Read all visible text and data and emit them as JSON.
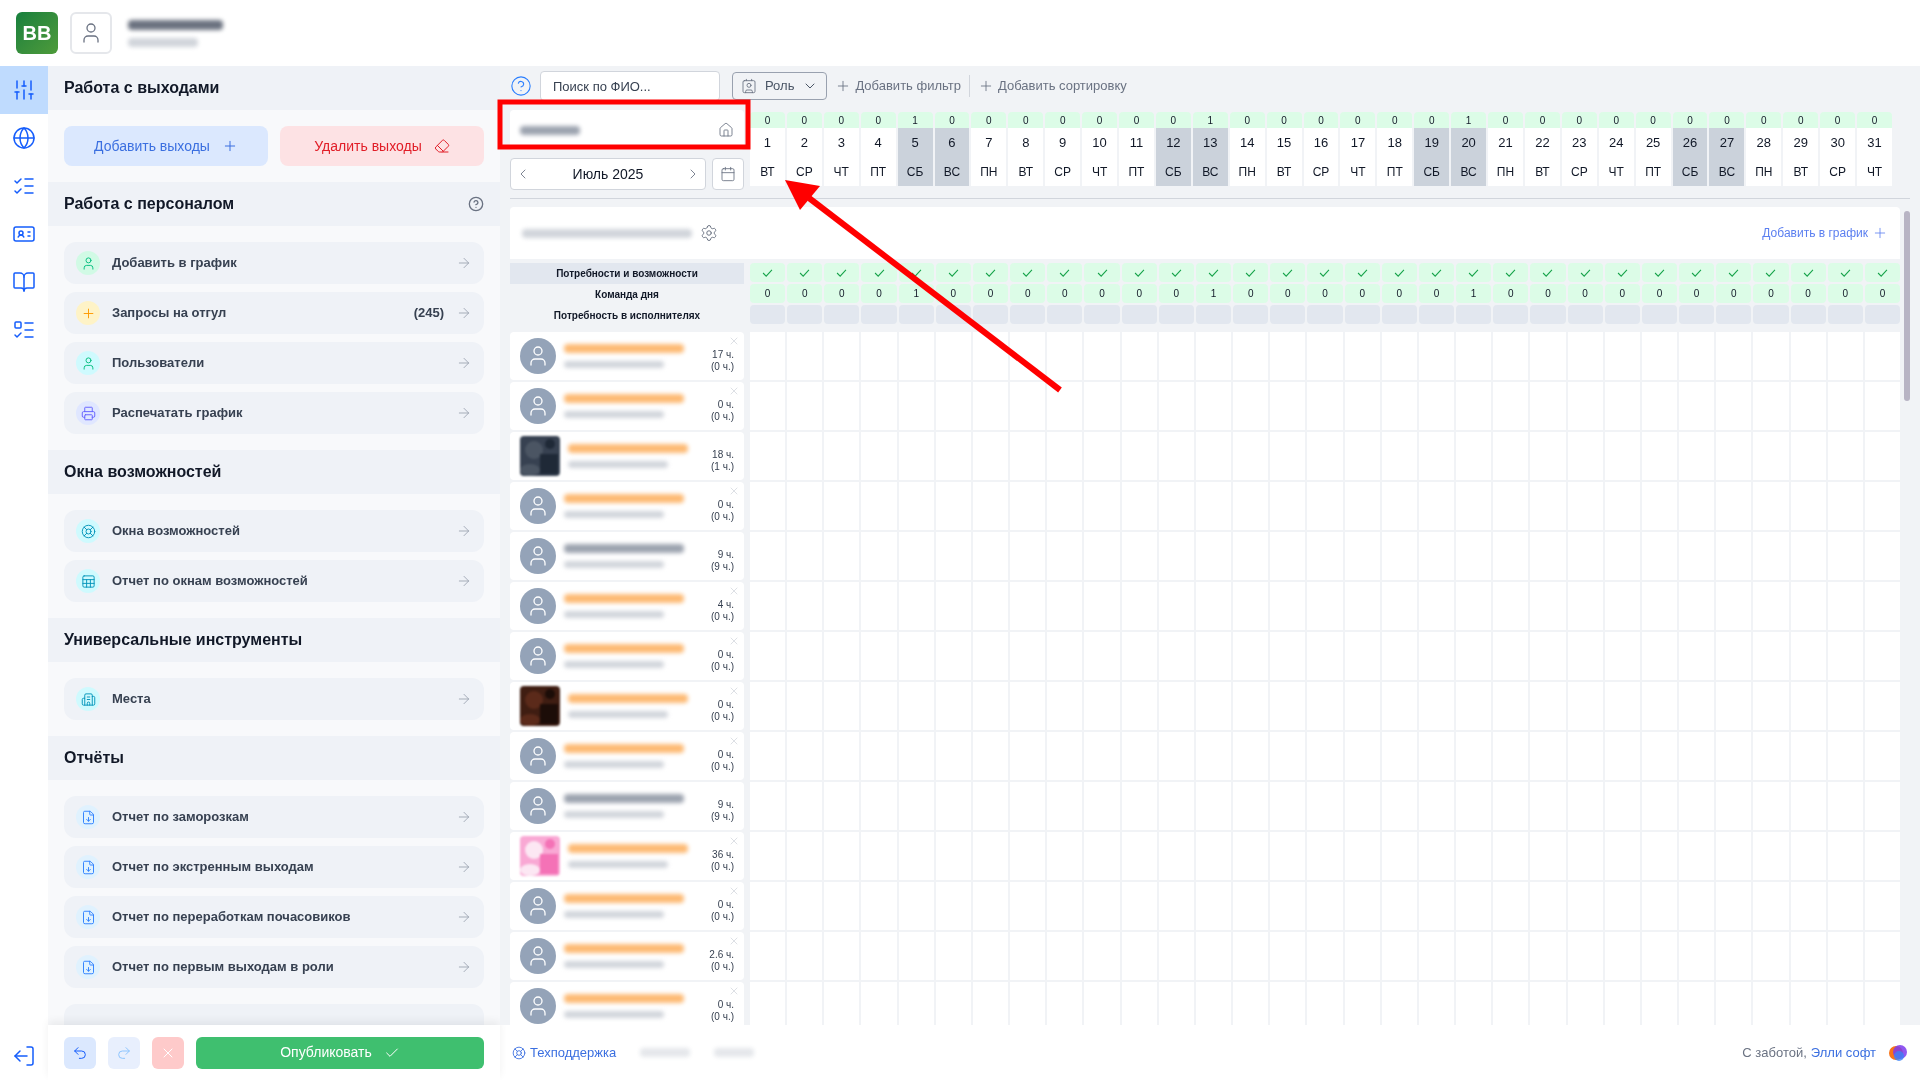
{
  "logo": "BB",
  "rail": [
    {
      "kind": "sliders",
      "selected": true
    },
    {
      "kind": "globe",
      "selected": false
    },
    {
      "kind": "checklist",
      "selected": false
    },
    {
      "kind": "card",
      "selected": false
    },
    {
      "kind": "book",
      "selected": false
    },
    {
      "kind": "tasks",
      "selected": false
    }
  ],
  "sections": [
    {
      "title": "Работа с выходами",
      "actions": [
        {
          "label": "Добавить выходы",
          "kind": "add"
        },
        {
          "label": "Удалить выходы",
          "kind": "delete"
        }
      ]
    },
    {
      "title": "Работа с персоналом",
      "help": true,
      "items": [
        {
          "label": "Добавить в график",
          "kind": "user",
          "color": "#d1fae5"
        },
        {
          "label": "Запросы на отгул",
          "kind": "plus",
          "color": "#fef3c7",
          "badge": "(245)"
        },
        {
          "label": "Пользователи",
          "kind": "user",
          "color": "#cffafe"
        },
        {
          "label": "Распечатать график",
          "kind": "printer",
          "color": "#e0e7ff"
        }
      ]
    },
    {
      "title": "Окна возможностей",
      "items": [
        {
          "label": "Окна возможностей",
          "kind": "lifebuoy",
          "color": "#cffafe"
        },
        {
          "label": "Отчет по окнам возможностей",
          "kind": "sheet",
          "color": "#cffafe"
        }
      ]
    },
    {
      "title": "Универсальные инструменты",
      "items": [
        {
          "label": "Места",
          "kind": "building",
          "color": "#cffafe"
        }
      ]
    },
    {
      "title": "Отчёты",
      "items": [
        {
          "label": "Отчет по заморозкам",
          "kind": "file",
          "color": "#e0f2fe"
        },
        {
          "label": "Отчет по экстренным выходам",
          "kind": "file",
          "color": "#e0f2fe"
        },
        {
          "label": "Отчет по переработкам почасовиков",
          "kind": "file",
          "color": "#e0f2fe"
        },
        {
          "label": "Отчет по первым выходам в роли",
          "kind": "file",
          "color": "#e0f2fe"
        }
      ]
    }
  ],
  "publish": "Опубликовать",
  "toolbar": {
    "placeholder": "Поиск по ФИО...",
    "role": "Роль",
    "add_filter": "Добавить фильтр",
    "add_sort": "Добавить сортировку"
  },
  "month": "Июль 2025",
  "add_to_schedule": "Добавить в график",
  "row_labels": [
    "Потребности и возможности",
    "Команда дня",
    "Потребность в исполнителях"
  ],
  "days": [
    {
      "num": "1",
      "weekday": "ВТ",
      "count": "0",
      "team": "0",
      "weekend": false,
      "ok": true
    },
    {
      "num": "2",
      "weekday": "СР",
      "count": "0",
      "team": "0",
      "weekend": false,
      "ok": true
    },
    {
      "num": "3",
      "weekday": "ЧТ",
      "count": "0",
      "team": "0",
      "weekend": false,
      "ok": true
    },
    {
      "num": "4",
      "weekday": "ПТ",
      "count": "0",
      "team": "0",
      "weekend": false,
      "ok": true
    },
    {
      "num": "5",
      "weekday": "СБ",
      "count": "1",
      "team": "1",
      "weekend": true,
      "ok": true
    },
    {
      "num": "6",
      "weekday": "ВС",
      "count": "0",
      "team": "0",
      "weekend": true,
      "ok": true
    },
    {
      "num": "7",
      "weekday": "ПН",
      "count": "0",
      "team": "0",
      "weekend": false,
      "ok": true
    },
    {
      "num": "8",
      "weekday": "ВТ",
      "count": "0",
      "team": "0",
      "weekend": false,
      "ok": true
    },
    {
      "num": "9",
      "weekday": "СР",
      "count": "0",
      "team": "0",
      "weekend": false,
      "ok": true
    },
    {
      "num": "10",
      "weekday": "ЧТ",
      "count": "0",
      "team": "0",
      "weekend": false,
      "ok": true
    },
    {
      "num": "11",
      "weekday": "ПТ",
      "count": "0",
      "team": "0",
      "weekend": false,
      "ok": true
    },
    {
      "num": "12",
      "weekday": "СБ",
      "count": "0",
      "team": "0",
      "weekend": true,
      "ok": true
    },
    {
      "num": "13",
      "weekday": "ВС",
      "count": "1",
      "team": "1",
      "weekend": true,
      "ok": true
    },
    {
      "num": "14",
      "weekday": "ПН",
      "count": "0",
      "team": "0",
      "weekend": false,
      "ok": true
    },
    {
      "num": "15",
      "weekday": "ВТ",
      "count": "0",
      "team": "0",
      "weekend": false,
      "ok": true
    },
    {
      "num": "16",
      "weekday": "СР",
      "count": "0",
      "team": "0",
      "weekend": false,
      "ok": true
    },
    {
      "num": "17",
      "weekday": "ЧТ",
      "count": "0",
      "team": "0",
      "weekend": false,
      "ok": true
    },
    {
      "num": "18",
      "weekday": "ПТ",
      "count": "0",
      "team": "0",
      "weekend": false,
      "ok": true
    },
    {
      "num": "19",
      "weekday": "СБ",
      "count": "0",
      "team": "0",
      "weekend": true,
      "ok": true
    },
    {
      "num": "20",
      "weekday": "ВС",
      "count": "1",
      "team": "1",
      "weekend": true,
      "ok": true
    },
    {
      "num": "21",
      "weekday": "ПН",
      "count": "0",
      "team": "0",
      "weekend": false,
      "ok": true
    },
    {
      "num": "22",
      "weekday": "ВТ",
      "count": "0",
      "team": "0",
      "weekend": false,
      "ok": true
    },
    {
      "num": "23",
      "weekday": "СР",
      "count": "0",
      "team": "0",
      "weekend": false,
      "ok": true
    },
    {
      "num": "24",
      "weekday": "ЧТ",
      "count": "0",
      "team": "0",
      "weekend": false,
      "ok": true
    },
    {
      "num": "25",
      "weekday": "ПТ",
      "count": "0",
      "team": "0",
      "weekend": false,
      "ok": true
    },
    {
      "num": "26",
      "weekday": "СБ",
      "count": "0",
      "team": "0",
      "weekend": true,
      "ok": true
    },
    {
      "num": "27",
      "weekday": "ВС",
      "count": "0",
      "team": "0",
      "weekend": true,
      "ok": true
    },
    {
      "num": "28",
      "weekday": "ПН",
      "count": "0",
      "team": "0",
      "weekend": false,
      "ok": true
    },
    {
      "num": "29",
      "weekday": "ВТ",
      "count": "0",
      "team": "0",
      "weekend": false,
      "ok": true
    },
    {
      "num": "30",
      "weekday": "СР",
      "count": "0",
      "team": "0",
      "weekend": false,
      "ok": true
    },
    {
      "num": "31",
      "weekday": "ЧТ",
      "count": "0",
      "team": "0",
      "weekend": false,
      "ok": true
    }
  ],
  "employees": [
    {
      "hours": "17 ч.",
      "extra": "(0 ч.)",
      "photo": false,
      "removable": true,
      "color": "#fdba74"
    },
    {
      "hours": "0 ч.",
      "extra": "(0 ч.)",
      "photo": false,
      "removable": true,
      "color": "#fdba74"
    },
    {
      "hours": "18 ч.",
      "extra": "(1 ч.)",
      "photo": true,
      "removable": false,
      "color": "#fdba74"
    },
    {
      "hours": "0 ч.",
      "extra": "(0 ч.)",
      "photo": false,
      "removable": true,
      "color": "#fdba74"
    },
    {
      "hours": "9 ч.",
      "extra": "(9 ч.)",
      "photo": false,
      "removable": false,
      "color": "#9ca3af"
    },
    {
      "hours": "4 ч.",
      "extra": "(0 ч.)",
      "photo": false,
      "removable": true,
      "color": "#fdba74"
    },
    {
      "hours": "0 ч.",
      "extra": "(0 ч.)",
      "photo": false,
      "removable": true,
      "color": "#fdba74"
    },
    {
      "hours": "0 ч.",
      "extra": "(0 ч.)",
      "photo": true,
      "removable": true,
      "color": "#fdba74"
    },
    {
      "hours": "0 ч.",
      "extra": "(0 ч.)",
      "photo": false,
      "removable": true,
      "color": "#fdba74"
    },
    {
      "hours": "9 ч.",
      "extra": "(9 ч.)",
      "photo": false,
      "removable": false,
      "color": "#9ca3af"
    },
    {
      "hours": "36 ч.",
      "extra": "(0 ч.)",
      "photo": true,
      "removable": true,
      "color": "#fdba74"
    },
    {
      "hours": "0 ч.",
      "extra": "(0 ч.)",
      "photo": false,
      "removable": true,
      "color": "#fdba74"
    },
    {
      "hours": "2.6 ч.",
      "extra": "(0 ч.)",
      "photo": false,
      "removable": true,
      "color": "#fdba74"
    },
    {
      "hours": "0 ч.",
      "extra": "(0 ч.)",
      "photo": false,
      "removable": true,
      "color": "#fdba74"
    }
  ],
  "footer": {
    "support": "Техподдержка",
    "credit": "С заботой,",
    "brand": "Элли софт"
  }
}
